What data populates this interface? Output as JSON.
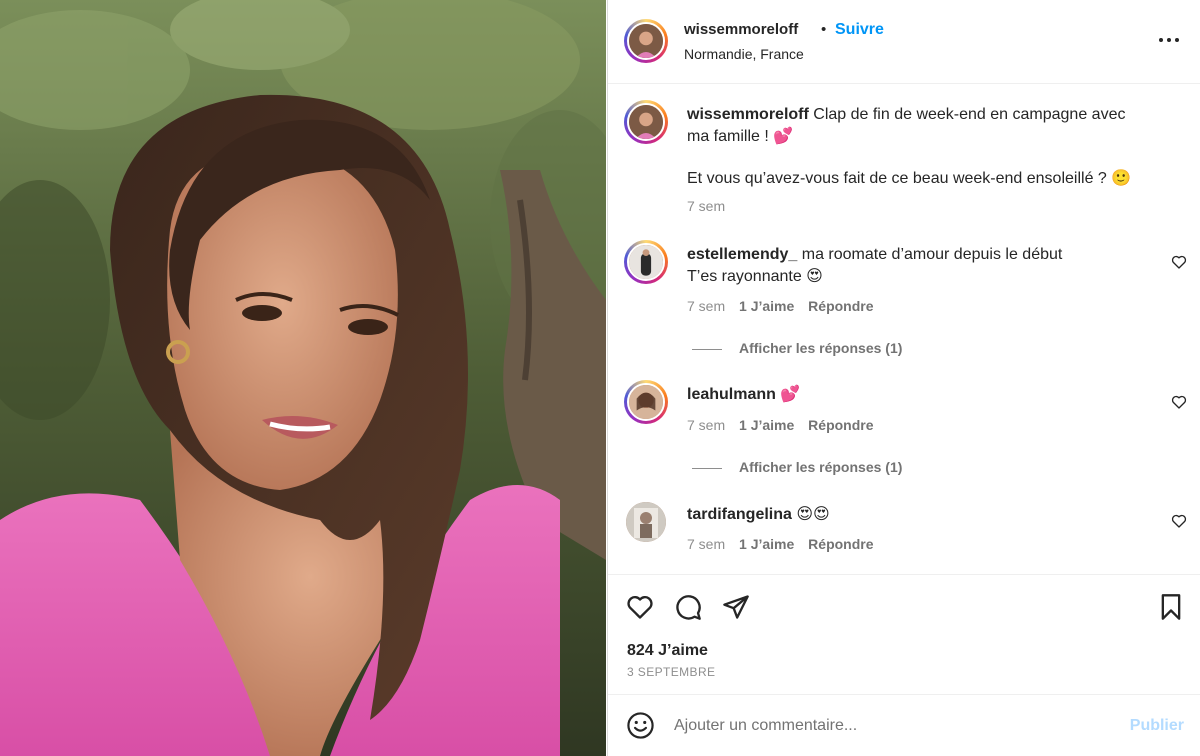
{
  "post": {
    "author": "wissemmoreloff",
    "separator": "•",
    "follow_label": "Suivre",
    "location": "Normandie, France",
    "caption_line1": "Clap de fin de week-end en campagne avec",
    "caption_line2": "ma famille ! 💕",
    "caption_line3": "Et vous qu’avez-vous fait de ce beau week-end ensoleillé ? 🙂",
    "caption_time": "7 sem"
  },
  "comments": [
    {
      "username": "estellemendy_",
      "text_line1": "ma roomate d’amour depuis le début",
      "text_line2": "T’es rayonnante 😍",
      "time": "7 sem",
      "likes": "1 J’aime",
      "reply_label": "Répondre",
      "view_replies": "Afficher les réponses (1)"
    },
    {
      "username": "leahulmann",
      "text_line1": "💕",
      "time": "7 sem",
      "likes": "1 J’aime",
      "reply_label": "Répondre",
      "view_replies": "Afficher les réponses (1)"
    },
    {
      "username": "tardifangelina",
      "text_line1": "😍😍",
      "time": "7 sem",
      "likes": "1 J’aime",
      "reply_label": "Répondre"
    }
  ],
  "stats": {
    "likes": "824 J’aime",
    "date": "3 SEPTEMBRE"
  },
  "composer": {
    "placeholder": "Ajouter un commentaire...",
    "publish_label": "Publier"
  },
  "icons": {
    "more": "more-options-icon",
    "like": "heart-icon",
    "comment": "comment-icon",
    "share": "share-icon",
    "save": "bookmark-icon",
    "emoji": "emoji-icon"
  },
  "colors": {
    "accent": "#0095f6",
    "publish_disabled": "#b3dbff",
    "secondary_text": "#8e8e8e",
    "photo_top": "#6f8450",
    "dress_pink": "#e25fb0"
  }
}
